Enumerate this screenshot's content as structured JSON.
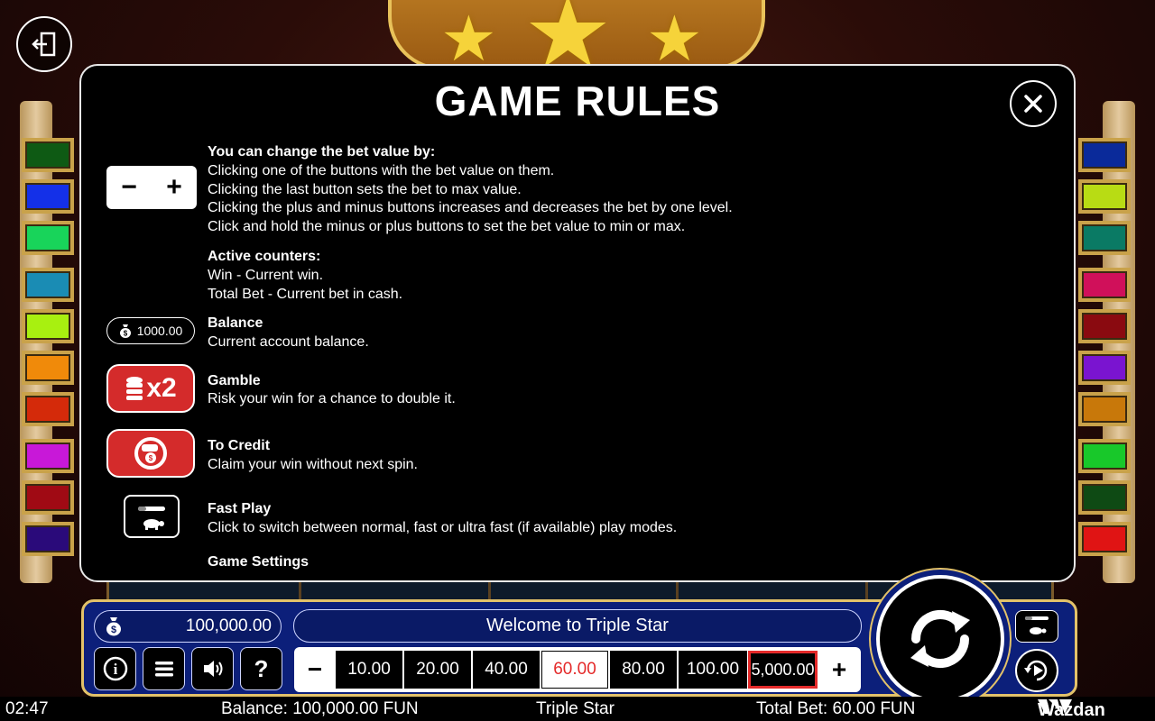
{
  "background": {
    "reel_col_offsets": [
      210,
      420,
      628,
      838
    ]
  },
  "colors": {
    "accent_red": "#d42b2b",
    "panel_blue": "#0c1f7a",
    "gold_border": "#e3c26a",
    "left_paylines": [
      "#0e5a14",
      "#1430e8",
      "#18d45a",
      "#1a8cb4",
      "#a8f010",
      "#f08a0a",
      "#d42a0a",
      "#c818d8",
      "#a00a14",
      "#2a0a7a"
    ],
    "right_paylines": [
      "#0a2a9a",
      "#b8dc14",
      "#0a7a64",
      "#d0105a",
      "#8a0a10",
      "#7a14d0",
      "#c8780a",
      "#18c82a",
      "#0e4a14",
      "#e01414"
    ]
  },
  "exit_icon": "exit-icon",
  "modal": {
    "title": "GAME RULES",
    "close_icon": "close-icon",
    "bet_section": {
      "heading": "You can change the bet value by:",
      "lines": [
        "Clicking one of the buttons with the bet value on them.",
        "Clicking the last button sets the bet to max value.",
        "Clicking the plus and minus buttons increases and decreases the bet by one level.",
        "Click and hold the minus or plus buttons to set the bet value to min or max."
      ],
      "icon_minus": "−",
      "icon_plus": "+"
    },
    "counters_section": {
      "heading": "Active counters:",
      "lines": [
        "Win - Current win.",
        "Total Bet - Current bet in cash."
      ]
    },
    "balance_section": {
      "icon_value": "1000.00",
      "heading": "Balance",
      "text": "Current account balance."
    },
    "gamble_section": {
      "icon_text": "x2",
      "heading": "Gamble",
      "text": "Risk your win for a chance to double it."
    },
    "credit_section": {
      "heading": "To Credit",
      "text": "Claim your win without next spin."
    },
    "fastplay_section": {
      "heading": "Fast Play",
      "text": "Click to switch between normal, fast or ultra fast (if available) play modes."
    },
    "settings_section": {
      "heading": "Game Settings"
    }
  },
  "panel": {
    "balance_value": "100,000.00",
    "message": "Welcome to Triple Star",
    "info_label": "i",
    "help_label": "?",
    "minus_label": "−",
    "plus_label": "+",
    "bet_values": [
      "10.00",
      "20.00",
      "40.00",
      "60.00",
      "80.00",
      "100.00",
      "5,000.00"
    ],
    "selected_bet": "60.00"
  },
  "status_bar": {
    "time": "02:47",
    "balance": "Balance: 100,000.00 FUN",
    "game_name": "Triple Star",
    "total_bet": "Total Bet: 60.00 FUN",
    "brand": "Wazdan"
  }
}
